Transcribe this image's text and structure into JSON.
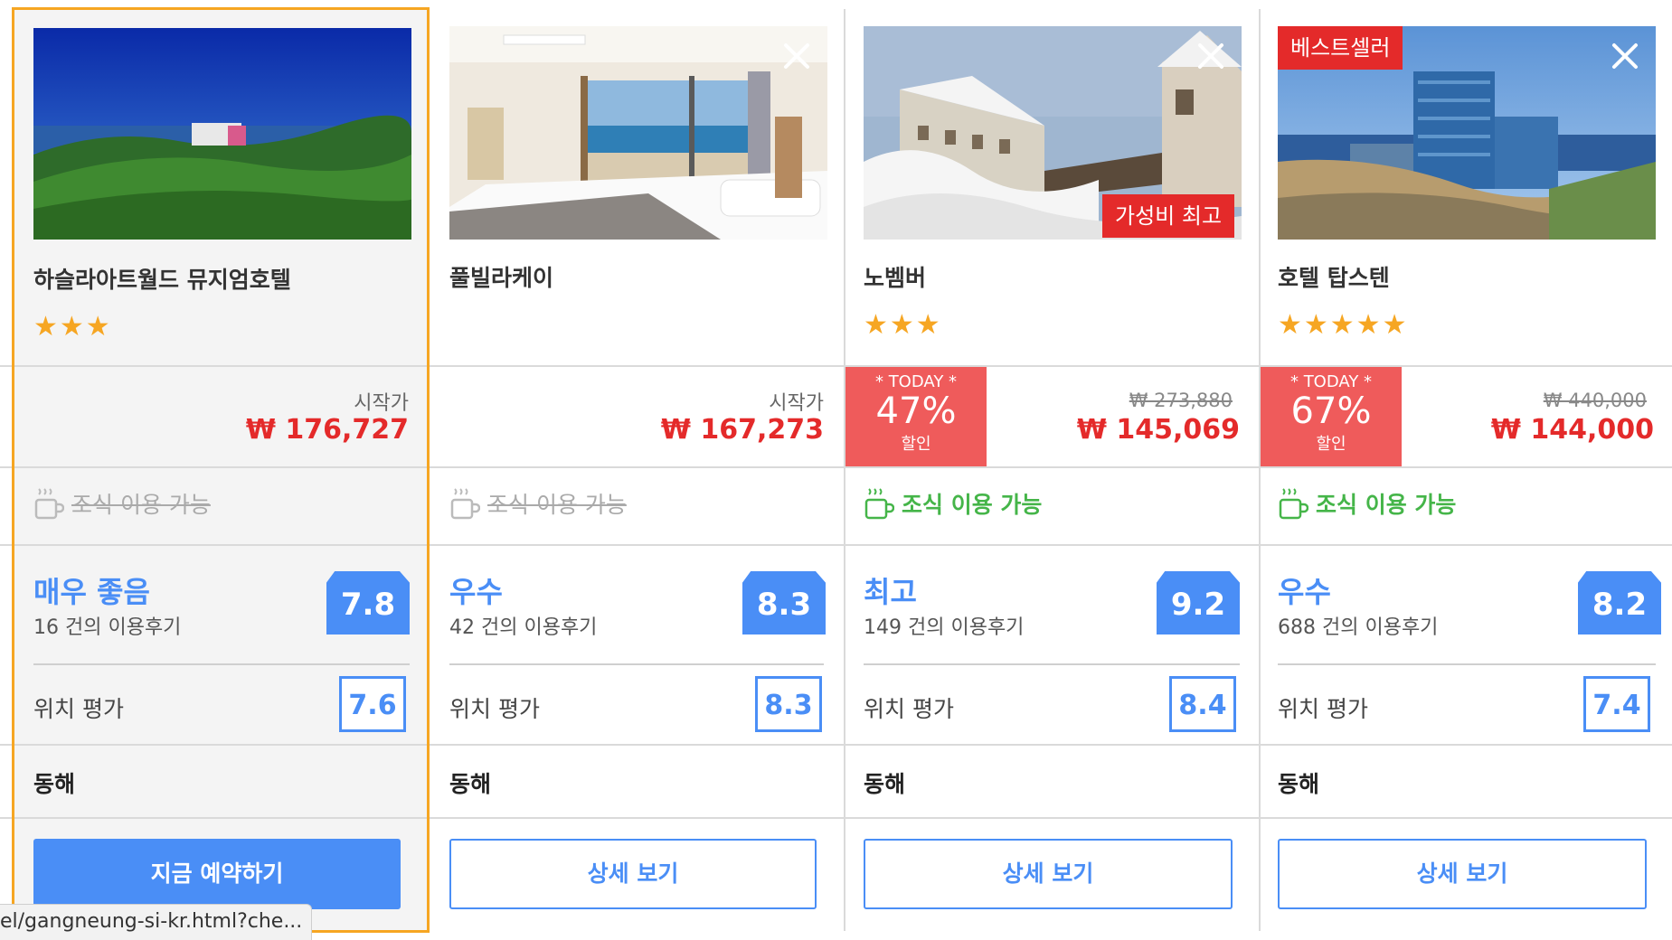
{
  "hotels": [
    {
      "name": "하슬라아트월드 뮤지엄호텔",
      "stars": "★★★",
      "start_label": "시작가",
      "price": "₩ 176,727",
      "breakfast": "조식 이용 가능",
      "breakfast_available": false,
      "rating_word": "매우 좋음",
      "reviews": "16 건의 이용후기",
      "score": "7.8",
      "location_label": "위치 평가",
      "location_score": "7.6",
      "region": "동해",
      "button": "지금 예약하기",
      "selected": true
    },
    {
      "name": "풀빌라케이",
      "stars": "",
      "start_label": "시작가",
      "price": "₩ 167,273",
      "breakfast": "조식 이용 가능",
      "breakfast_available": false,
      "rating_word": "우수",
      "reviews": "42 건의 이용후기",
      "score": "8.3",
      "location_label": "위치 평가",
      "location_score": "8.3",
      "region": "동해",
      "button": "상세 보기",
      "selected": false
    },
    {
      "name": "노벰버",
      "stars": "★★★",
      "badge": "가성비 최고",
      "deal_today": "* TODAY *",
      "deal_percent": "47%",
      "deal_label": "할인",
      "old_price": "₩ 273,880",
      "price": "₩ 145,069",
      "breakfast": "조식 이용 가능",
      "breakfast_available": true,
      "rating_word": "최고",
      "reviews": "149 건의 이용후기",
      "score": "9.2",
      "location_label": "위치 평가",
      "location_score": "8.4",
      "region": "동해",
      "button": "상세 보기",
      "selected": false
    },
    {
      "name": "호텔 탑스텐",
      "stars": "★★★★★",
      "badge": "베스트셀러",
      "deal_today": "* TODAY *",
      "deal_percent": "67%",
      "deal_label": "할인",
      "old_price": "₩ 440,000",
      "price": "₩ 144,000",
      "breakfast": "조식 이용 가능",
      "breakfast_available": true,
      "rating_word": "우수",
      "reviews": "688 건의 이용후기",
      "score": "8.2",
      "location_label": "위치 평가",
      "location_score": "7.4",
      "region": "동해",
      "button": "상세 보기",
      "selected": false
    }
  ],
  "status_url": "el/gangneung-si-kr.html?che...",
  "colors": {
    "accent_blue": "#4a8ef6",
    "price_red": "#e42a2a",
    "deal_red": "#ef5b5b",
    "breakfast_green": "#45b549",
    "star_orange": "#f6a623",
    "selected_border": "#f6a623"
  }
}
